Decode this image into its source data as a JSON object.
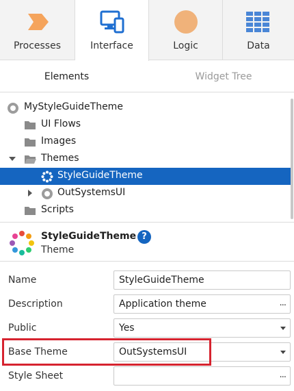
{
  "tabs": [
    {
      "label": "Processes",
      "icon": "processes-icon",
      "active": false
    },
    {
      "label": "Interface",
      "icon": "interface-icon",
      "active": true
    },
    {
      "label": "Logic",
      "icon": "logic-icon",
      "active": false
    },
    {
      "label": "Data",
      "icon": "data-icon",
      "active": false
    }
  ],
  "subtabs": {
    "elements": "Elements",
    "widget_tree": "Widget Tree"
  },
  "tree": {
    "root": "MyStyleGuideTheme",
    "ui_flows": "UI Flows",
    "images": "Images",
    "themes": "Themes",
    "selected_theme": "StyleGuideTheme",
    "outsystems_ui": "OutSystemsUI",
    "scripts": "Scripts"
  },
  "details": {
    "title": "StyleGuideTheme",
    "type": "Theme",
    "help": "?"
  },
  "properties": {
    "name": {
      "label": "Name",
      "value": "StyleGuideTheme"
    },
    "description": {
      "label": "Description",
      "value": "Application theme",
      "button": "..."
    },
    "public": {
      "label": "Public",
      "value": "Yes"
    },
    "base_theme": {
      "label": "Base Theme",
      "value": "OutSystemsUI"
    },
    "style_sheet": {
      "label": "Style Sheet",
      "value": "",
      "button": "..."
    }
  },
  "colors": {
    "accent": "#1565c0",
    "processes_orange": "#f5a45c",
    "logic_orange": "#f0b27a",
    "interface_blue": "#1f6fd1",
    "data_blue": "#4a86d6",
    "highlight_red": "#d6232f"
  }
}
